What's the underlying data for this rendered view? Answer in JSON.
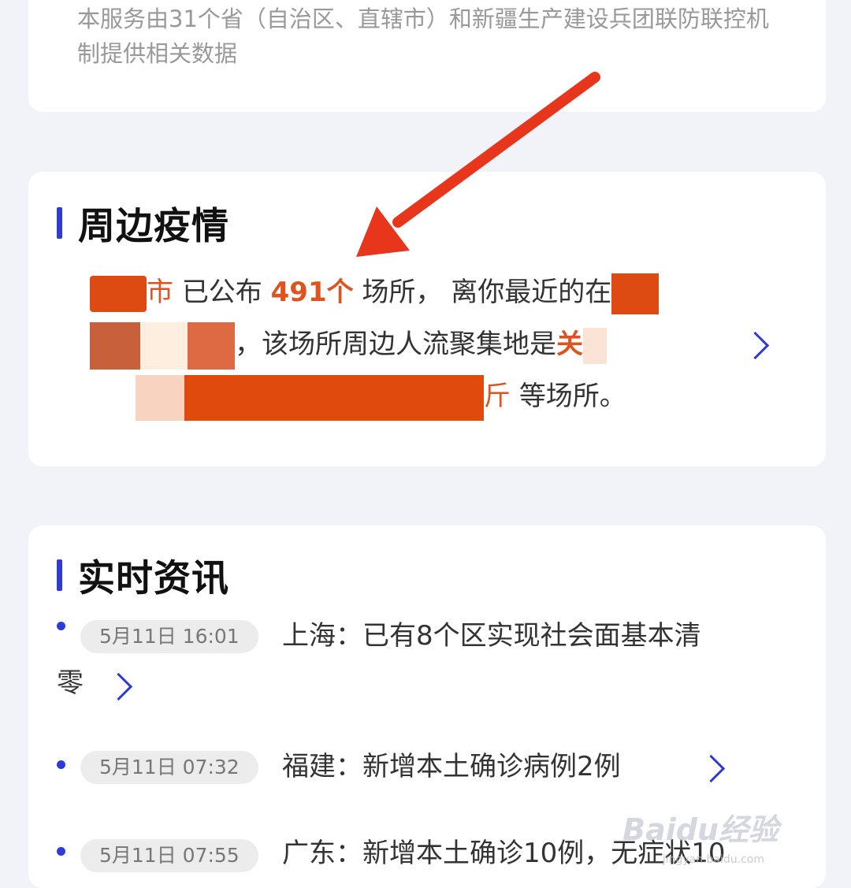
{
  "top_card": {
    "source_text": "本服务由31个省（自治区、直辖市）和新疆生产建设兵团联防联控机制提供相关数据"
  },
  "nearby": {
    "title": "周边疫情",
    "city_suffix": "市",
    "text_published": "已公布",
    "count": "491个",
    "text_places": "场所，",
    "text_nearest": "离你最近的在",
    "text_crowd": "，该场所周边人流聚集地是",
    "crowd_char": "关",
    "text_end_char": "斤",
    "text_etc": "等场所。"
  },
  "news": {
    "title": "实时资讯",
    "items": [
      {
        "time": "5月11日 16:01",
        "title_line1": "上海：已有8个区实现社会面基本清",
        "title_line2": "零"
      },
      {
        "time": "5月11日 07:32",
        "title_line1": "福建：新增本土确诊病例2例"
      },
      {
        "time": "5月11日 07:55",
        "title_line1": "广东：新增本土确诊10例，无症状10"
      }
    ]
  },
  "watermark": {
    "brand": "Baidu经验",
    "url": "jingyan.baidu.com"
  },
  "colors": {
    "accent": "#2f3bd6",
    "highlight": "#e0531f",
    "arrow": "#e8361c"
  }
}
